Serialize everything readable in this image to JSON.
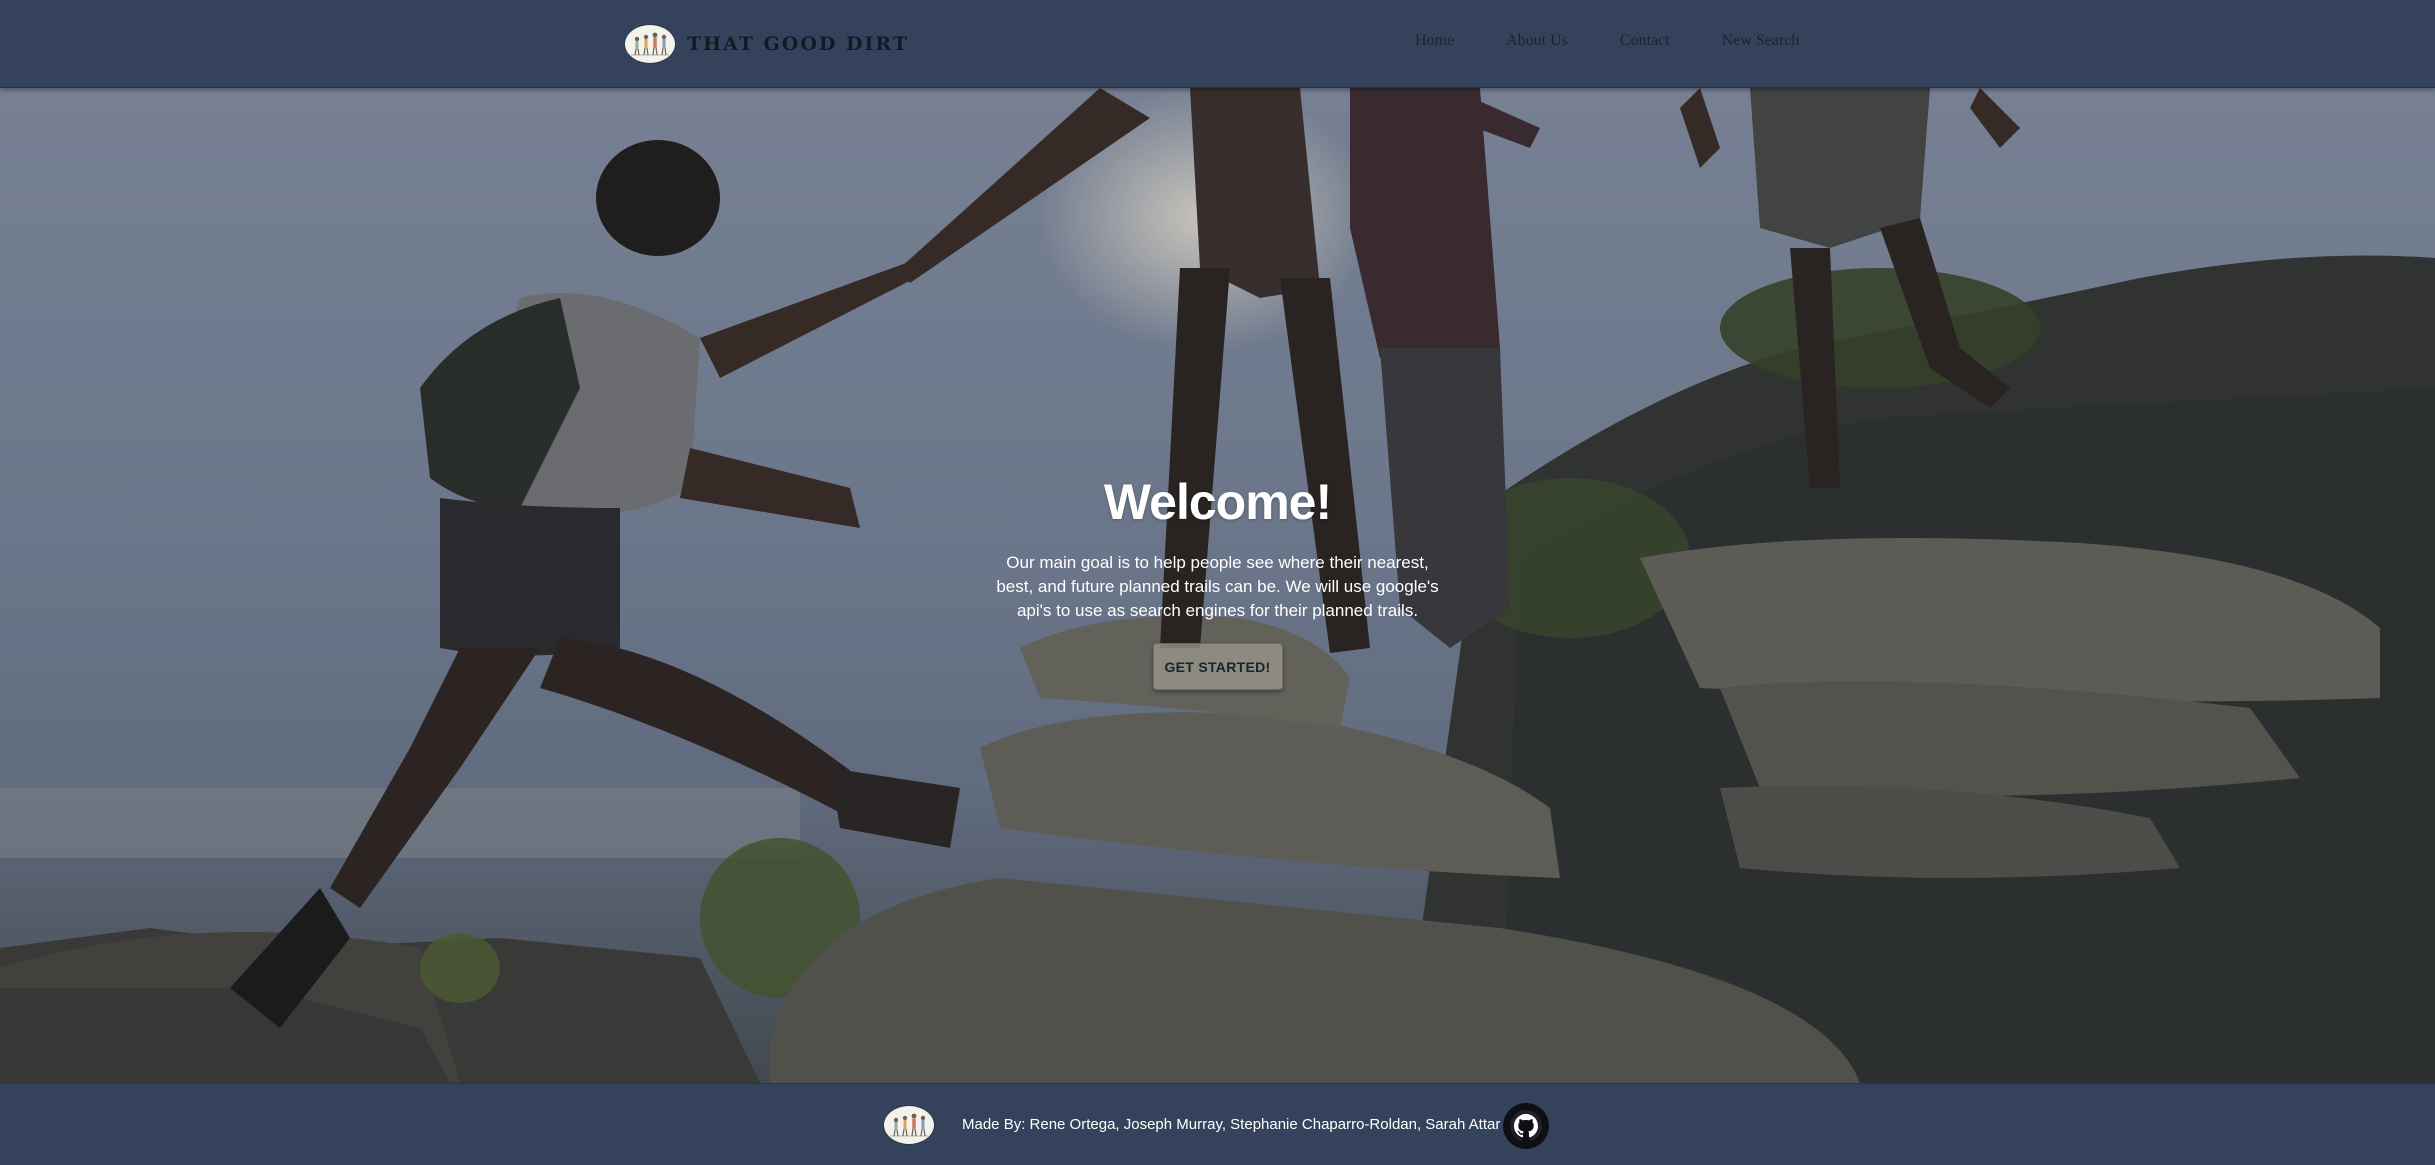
{
  "navbar": {
    "brand_name": "THAT GOOD DIRT",
    "logo_icon": "hikers-logo-icon",
    "links": [
      "Home",
      "About Us",
      "Contact",
      "New Search"
    ]
  },
  "hero": {
    "title": "Welcome!",
    "text": "Our main goal is to help people see where their nearest, best, and future planned trails can be. We will use google's api's to use as search engines for their planned trails.",
    "button_label": "GET STARTED!",
    "background_image": "hikers-helping-on-rocky-mountain-photo"
  },
  "footer": {
    "credits": "Made By: Rene Ortega, Joseph Murray, Stephanie Chaparro-Roldan, Sarah Attar",
    "logo_icon": "hikers-logo-icon",
    "github_icon": "github-icon"
  },
  "colors": {
    "navbar_bg": "#34435b",
    "footer_bg": "#34435b",
    "brand_text": "#141a24",
    "hero_text": "#ffffff",
    "button_bg": "#9b968c"
  }
}
